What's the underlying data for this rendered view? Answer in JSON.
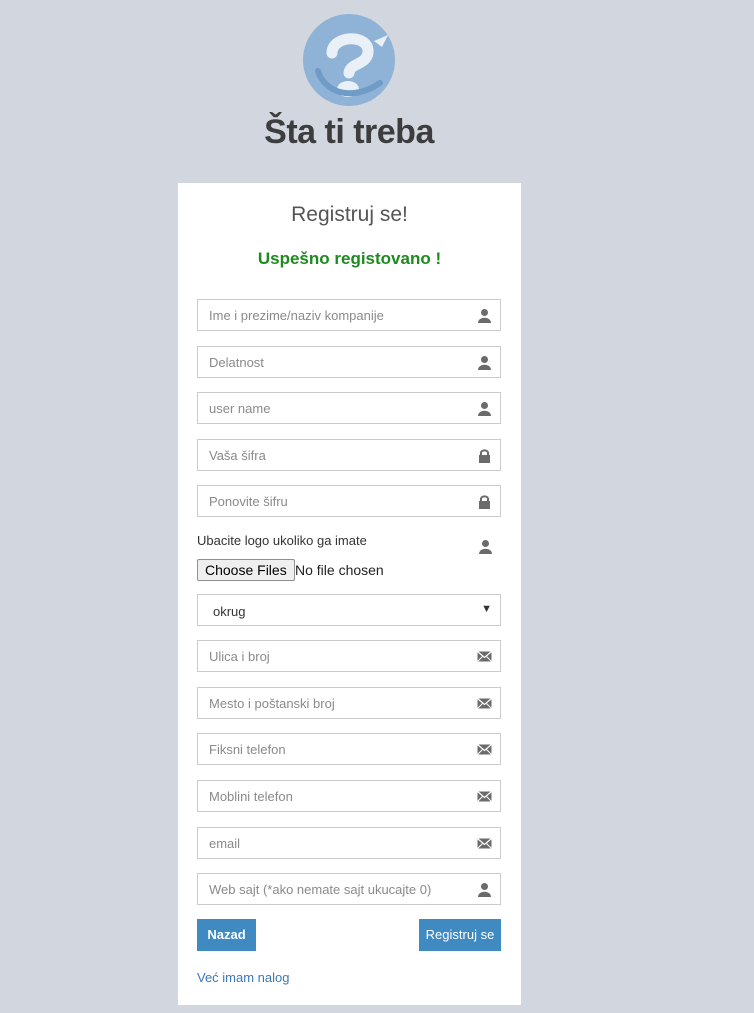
{
  "header": {
    "site_title": "Šta ti treba"
  },
  "form": {
    "title": "Registruj se!",
    "success_message": "Uspešno registovano !",
    "fields": [
      {
        "placeholder": "Ime i prezime/naziv kompanije",
        "icon": "user-icon"
      },
      {
        "placeholder": "Delatnost",
        "icon": "user-icon"
      },
      {
        "placeholder": "user name",
        "icon": "user-icon"
      },
      {
        "placeholder": "Vaša šifra",
        "icon": "lock-icon"
      },
      {
        "placeholder": "Ponovite šifru",
        "icon": "lock-icon"
      }
    ],
    "logo_upload": {
      "label": "Ubacite logo ukoliko ga imate",
      "button_label": "Choose Files",
      "status": "No file chosen",
      "icon": "user-icon"
    },
    "district_select": {
      "value": "okrug"
    },
    "address_fields": [
      {
        "placeholder": "Ulica i broj",
        "icon": "envelope-icon"
      },
      {
        "placeholder": "Mesto i poštanski broj",
        "icon": "envelope-icon"
      },
      {
        "placeholder": "Fiksni telefon",
        "icon": "envelope-icon"
      },
      {
        "placeholder": "Moblini telefon",
        "icon": "envelope-icon"
      },
      {
        "placeholder": "email",
        "icon": "envelope-icon"
      },
      {
        "placeholder": "Web sajt (*ako nemate sajt ukucajte 0)",
        "icon": "user-icon"
      }
    ],
    "back_button": "Nazad",
    "submit_button": "Registruj se",
    "login_link": "Već imam nalog"
  },
  "colors": {
    "background": "#d1d6df",
    "card": "#ffffff",
    "success": "#1f8a1f",
    "primary_button": "#3f8ac1",
    "link": "#3a79b8",
    "logo": "#7fa8cf"
  }
}
